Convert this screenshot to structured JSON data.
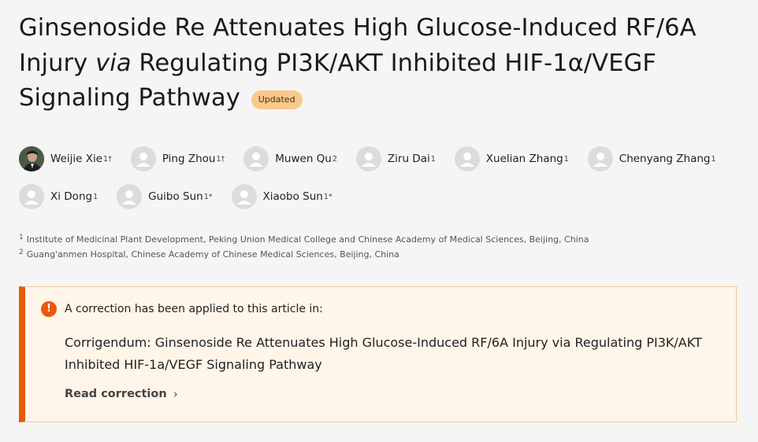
{
  "article": {
    "title_part1": "Ginsenoside Re Attenuates High Glucose-Induced RF/6A Injury ",
    "title_italic": "via",
    "title_part2": " Regulating PI3K/AKT Inhibited HIF-1α/VEGF Signaling Pathway",
    "badge": "Updated"
  },
  "authors": [
    {
      "name": "Weijie Xie",
      "sup": "1†",
      "avatar": "photo"
    },
    {
      "name": "Ping Zhou",
      "sup": "1†",
      "avatar": "person-icon"
    },
    {
      "name": "Muwen Qu",
      "sup": "2",
      "avatar": "person-icon"
    },
    {
      "name": "Ziru Dai",
      "sup": "1",
      "avatar": "person-icon"
    },
    {
      "name": "Xuelian Zhang",
      "sup": "1",
      "avatar": "person-icon"
    },
    {
      "name": "Chenyang Zhang",
      "sup": "1",
      "avatar": "person-icon"
    },
    {
      "name": "Xi Dong",
      "sup": "1",
      "avatar": "person-icon"
    },
    {
      "name": "Guibo Sun",
      "sup": "1*",
      "avatar": "person-icon"
    },
    {
      "name": "Xiaobo Sun",
      "sup": "1*",
      "avatar": "person-icon"
    }
  ],
  "affiliations": [
    {
      "num": "1",
      "text": "Institute of Medicinal Plant Development, Peking Union Medical College and Chinese Academy of Medical Sciences, Beijing, China"
    },
    {
      "num": "2",
      "text": "Guang'anmen Hospital, Chinese Academy of Chinese Medical Sciences, Beijing, China"
    }
  ],
  "correction": {
    "icon": "exclamation-icon",
    "heading": "A correction has been applied to this article in:",
    "text": "Corrigendum: Ginsenoside Re Attenuates High Glucose-Induced RF/6A Injury via Regulating PI3K/AKT Inhibited HIF-1a/VEGF Signaling Pathway",
    "link_label": "Read correction",
    "link_icon": "chevron-right-icon"
  },
  "colors": {
    "accent": "#e8590c",
    "badge_bg": "#fbc88c",
    "correction_bg": "#fff5e8"
  }
}
